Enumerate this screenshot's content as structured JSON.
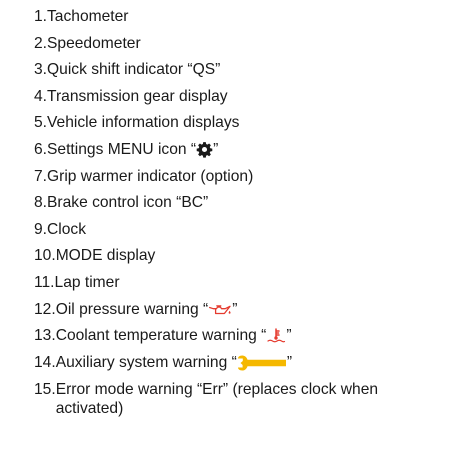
{
  "items": [
    {
      "number": "1. ",
      "text": "Tachometer"
    },
    {
      "number": "2. ",
      "text": "Speedometer"
    },
    {
      "number": "3. ",
      "text": "Quick shift indicator “QS”"
    },
    {
      "number": "4. ",
      "text": "Transmission gear display"
    },
    {
      "number": "5. ",
      "text": "Vehicle information displays"
    },
    {
      "number": "6. ",
      "text_before": "Settings MENU icon “",
      "icon": "gear-icon",
      "text_after": "”"
    },
    {
      "number": "7. ",
      "text": "Grip warmer indicator (option)"
    },
    {
      "number": "8. ",
      "text": "Brake control icon “BC”"
    },
    {
      "number": "9. ",
      "text": "Clock"
    },
    {
      "number": "10.",
      "text": "MODE display"
    },
    {
      "number": "11.",
      "text": "Lap timer"
    },
    {
      "number": "12.",
      "text_before": "Oil pressure warning “",
      "icon": "oil-can-icon",
      "text_after": "”"
    },
    {
      "number": "13.",
      "text_before": "Coolant temperature warning “",
      "icon": "coolant-thermometer-icon",
      "text_after": "”"
    },
    {
      "number": "14.",
      "text_before": "Auxiliary system warning “",
      "icon": "wrench-icon",
      "text_after": "”"
    },
    {
      "number": "15.",
      "text": "Error mode warning “Err” (replaces clock when activated)"
    }
  ],
  "colors": {
    "text": "#1a1a1a",
    "warning_red": "#e53b2f",
    "wrench_yellow": "#f5b800"
  }
}
